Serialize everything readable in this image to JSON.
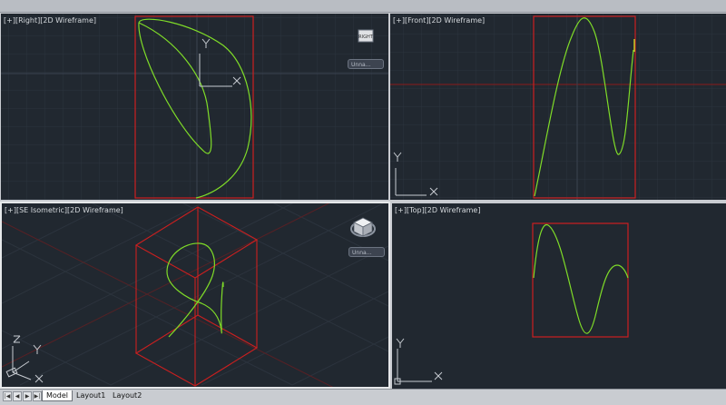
{
  "viewports": {
    "right": {
      "label": "[+][Right][2D Wireframe]"
    },
    "front": {
      "label": "[+][Front][2D Wireframe]"
    },
    "iso": {
      "label": "[+][SE Isometric][2D Wireframe]"
    },
    "top": {
      "label": "[+][Top][2D Wireframe]"
    }
  },
  "viewcube": {
    "right_face_label": "RIGHT",
    "named_view_button": "Unna..."
  },
  "axes": {
    "x": "X",
    "y": "Y",
    "z": "Z"
  },
  "tabs": {
    "model": "Model",
    "layout1": "Layout1",
    "layout2": "Layout2"
  },
  "nav_icons": [
    "first-tab-icon",
    "prev-tab-icon",
    "next-tab-icon",
    "last-tab-icon"
  ],
  "colors": {
    "background": "#212830",
    "curve": "#7fdc28",
    "bounding_box": "#cc1f1f",
    "axis_line": "#8a1a1a",
    "ucs_icon": "#c8ccd2"
  }
}
